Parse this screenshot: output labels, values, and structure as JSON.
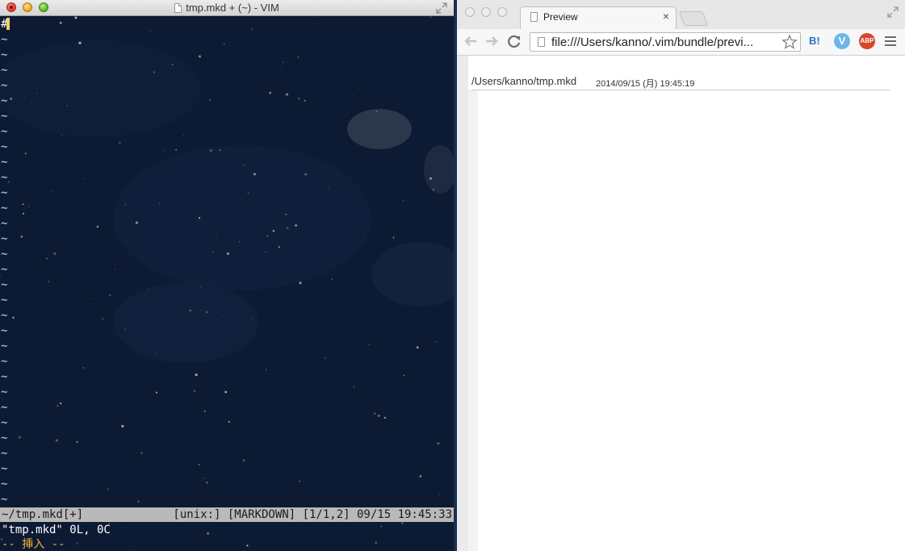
{
  "vim": {
    "window_title": "tmp.mkd + (~) - VIM",
    "first_line_char": "#",
    "tilde": "~",
    "tilde_rows": 31,
    "statusline_left": "~/tmp.mkd[+]",
    "statusline_right": "[unix:] [MARKDOWN] [1/1,2] 09/15 19:45:33",
    "message": "\"tmp.mkd\" 0L, 0C",
    "mode": "-- 挿入 --",
    "colors": {
      "background": "#0c1a33",
      "statusline": "#b9b9b9",
      "mode": "#f3b13b",
      "cursor": "#f6d265",
      "tilde": "#8fb7d8"
    }
  },
  "browser": {
    "tab_title": "Preview",
    "tab_close": "×",
    "address": "file:///Users/kanno/.vim/bundle/previ...",
    "extensions": {
      "hatena": "B!",
      "v": "V",
      "abp": "ABP"
    },
    "preview": {
      "path": "/Users/kanno/tmp.mkd",
      "timestamp": "2014/09/15 (月) 19:45:19"
    }
  }
}
